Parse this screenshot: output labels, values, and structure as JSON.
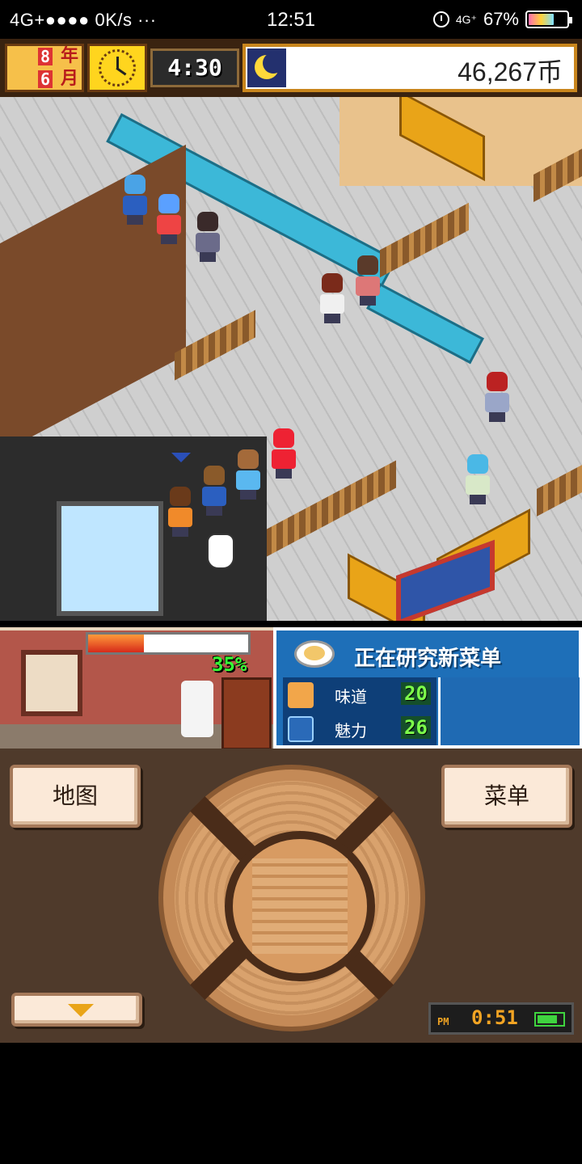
{
  "status_bar": {
    "network": "4G+●●●● 0K/s ···",
    "time": "12:51",
    "signal_label": "4G⁺",
    "battery": "67%",
    "icons": [
      "alarm-icon",
      "signal-icon",
      "battery-icon"
    ]
  },
  "hud": {
    "year_number": "8",
    "year_unit": "年",
    "month_number": "6",
    "month_unit": "月",
    "time": "4:30",
    "money": "46,267币",
    "icons": [
      "clock-icon",
      "moon-icon"
    ]
  },
  "research": {
    "progress_label": "35%",
    "progress_value": 0.35,
    "title": "正在研究新菜单",
    "stats": [
      {
        "label": "味道",
        "value": "20",
        "icon": "flavor-icon"
      },
      {
        "label": "魅力",
        "value": "26",
        "icon": "charm-icon"
      }
    ]
  },
  "controls": {
    "map_button": "地图",
    "menu_button": "菜单",
    "mini_time_period": "PM",
    "mini_time": "0:51"
  },
  "colors": {
    "hud_gold": "#f6c04a",
    "panel_blue": "#1e6fb8",
    "stat_green": "#7cff4a",
    "control_bg": "#4f3a2b"
  }
}
